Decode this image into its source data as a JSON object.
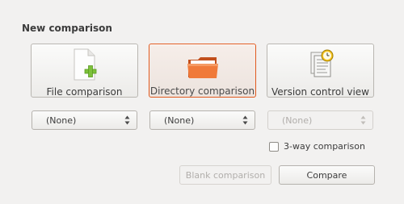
{
  "section_title": "New comparison",
  "buttons": {
    "file": {
      "label": "File comparison",
      "icon": "file-add-icon"
    },
    "directory": {
      "label": "Directory comparison",
      "icon": "folder-icon"
    },
    "vcs": {
      "label": "Version control view",
      "icon": "version-control-icon"
    }
  },
  "selectors": {
    "file": {
      "value": "(None)"
    },
    "directory": {
      "value": "(None)"
    },
    "vcs": {
      "value": "(None)"
    }
  },
  "three_way": {
    "label": "3-way comparison",
    "checked": false
  },
  "actions": {
    "blank": "Blank comparison",
    "compare": "Compare"
  },
  "colors": {
    "accent": "#e15a1f",
    "plus_green": "#7dc13a",
    "folder_orange": "#f07a3a",
    "clock_yellow": "#f4c21c"
  }
}
